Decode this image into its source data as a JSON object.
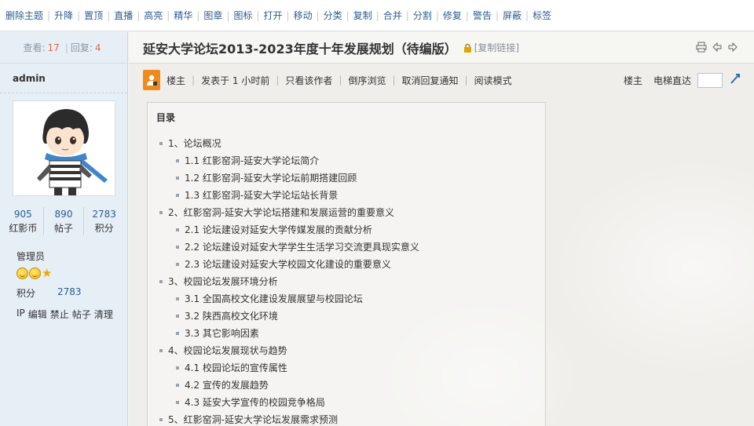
{
  "admin_bar": {
    "items": [
      "删除主题",
      "升降",
      "置顶",
      "直播",
      "高亮",
      "精华",
      "图章",
      "图标",
      "打开",
      "移动",
      "分类",
      "复制",
      "合并",
      "分割",
      "修复",
      "警告",
      "屏蔽",
      "标签"
    ]
  },
  "stats": {
    "views_label": "查看:",
    "views": "17",
    "replies_label": "回复:",
    "replies": "4"
  },
  "author": {
    "name": "admin",
    "counters": [
      {
        "value": "905",
        "label": "红影币"
      },
      {
        "value": "890",
        "label": "帖子"
      },
      {
        "value": "2783",
        "label": "积分"
      }
    ],
    "group": "管理员",
    "points_label": "积分",
    "points_value": "2783",
    "mgmt": [
      "IP",
      "编辑",
      "禁止",
      "帖子",
      "清理"
    ]
  },
  "post": {
    "title": "延安大学论坛2013-2023年度十年发展规划（待编版）",
    "copy_link": "[复制链接]",
    "meta": [
      "楼主",
      "发表于 1 小时前",
      "只看该作者",
      "倒序浏览",
      "取消回复通知",
      "阅读模式"
    ],
    "floor_label": "楼主",
    "jump_label": "电梯直达"
  },
  "toc": {
    "heading": "目录",
    "items": [
      {
        "level": 1,
        "text": "1、论坛概况"
      },
      {
        "level": 2,
        "text": "1.1 红影窑洞-延安大学论坛简介"
      },
      {
        "level": 2,
        "text": "1.2 红影窑洞-延安大学论坛前期搭建回顾"
      },
      {
        "level": 2,
        "text": "1.3 红影窑洞-延安大学论坛站长背景"
      },
      {
        "level": 1,
        "text": "2、红影窑洞-延安大学论坛搭建和发展运营的重要意义"
      },
      {
        "level": 2,
        "text": "2.1 论坛建设对延安大学传媒发展的贡献分析"
      },
      {
        "level": 2,
        "text": "2.2 论坛建设对延安大学学生生活学习交流更具现实意义"
      },
      {
        "level": 2,
        "text": "2.3 论坛建设对延安大学校园文化建设的重要意义"
      },
      {
        "level": 1,
        "text": "3、校园论坛发展环境分析"
      },
      {
        "level": 2,
        "text": "3.1 全国高校文化建设发展展望与校园论坛"
      },
      {
        "level": 2,
        "text": "3.2 陕西高校文化环境"
      },
      {
        "level": 2,
        "text": "3.3 其它影响因素"
      },
      {
        "level": 1,
        "text": "4、校园论坛发展现状与趋势"
      },
      {
        "level": 2,
        "text": "4.1 校园论坛的宣传属性"
      },
      {
        "level": 2,
        "text": "4.2 宣传的发展趋势"
      },
      {
        "level": 2,
        "text": "4.3 延安大学宣传的校园竞争格局"
      },
      {
        "level": 1,
        "text": "5、红影窑洞-延安大学论坛发展需求预测"
      }
    ]
  }
}
